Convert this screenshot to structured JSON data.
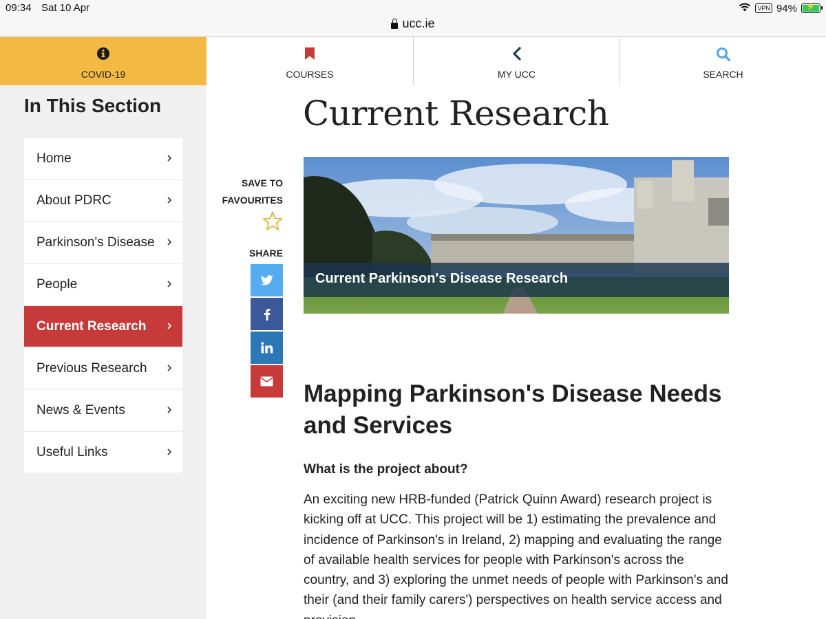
{
  "status": {
    "time": "09:34",
    "date": "Sat 10 Apr",
    "vpn": "VPN",
    "battery": "94%",
    "battery_level": 0.94
  },
  "browser": {
    "url": "ucc.ie"
  },
  "topnav": {
    "covid": "COVID-19",
    "courses": "COURSES",
    "my_ucc": "MY UCC",
    "search": "SEARCH"
  },
  "sidebar": {
    "heading": "In This Section",
    "items": [
      {
        "label": "Home"
      },
      {
        "label": "About PDRC"
      },
      {
        "label": "Parkinson's Disease"
      },
      {
        "label": "People"
      },
      {
        "label": "Current Research",
        "active": true
      },
      {
        "label": "Previous Research"
      },
      {
        "label": "News & Events"
      },
      {
        "label": "Useful Links"
      }
    ]
  },
  "main": {
    "title": "Current Research",
    "save_line1": "SAVE TO",
    "save_line2": "FAVOURITES",
    "share": "SHARE",
    "share_buttons": [
      {
        "icon": "twitter-icon",
        "color": "#55acee"
      },
      {
        "icon": "facebook-icon",
        "color": "#3b5998"
      },
      {
        "icon": "linkedin-icon",
        "color": "#2e77b6"
      },
      {
        "icon": "email-icon",
        "color": "#c73a3a"
      }
    ],
    "hero_caption": "Current Parkinson's Disease Research",
    "heading": "Mapping Parkinson's Disease Needs and Services",
    "subheading": "What is the project about?",
    "paragraph": "An exciting new HRB-funded (Patrick Quinn Award) research project is kicking off at UCC. This project will be 1) estimating the prevalence and incidence of Parkinson's in Ireland, 2) mapping and evaluating the range of available health services for people with Parkinson's across the country, and 3) exploring the unmet needs of people with Parkinson's and their (and their family carers') perspectives on health service access and provision."
  },
  "colors": {
    "covid_bg": "#f3b942",
    "active_bg": "#c73a3a",
    "sidebar_bg": "#f0f0f0",
    "icon_red": "#c73a3a",
    "icon_navy": "#1f3a5a",
    "icon_blue": "#5aa4d8",
    "star": "#e0b23a"
  }
}
